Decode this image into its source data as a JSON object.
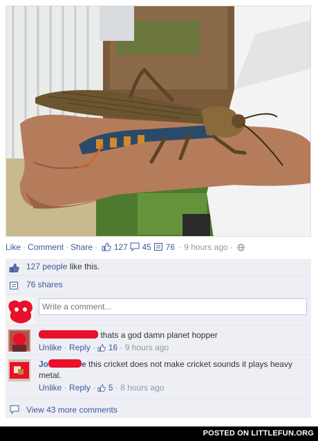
{
  "post": {
    "photo_subject": "giant grasshopper on a man's arm",
    "actions": {
      "like": "Like",
      "comment": "Comment",
      "share": "Share",
      "likes_count": "127",
      "comments_count": "45",
      "shares_count": "76",
      "time": "9 hours ago",
      "privacy_icon": "globe-icon"
    }
  },
  "feedback": {
    "likes_link": "127 people",
    "likes_text": " like this.",
    "shares_text": "76 shares",
    "write_placeholder": "Write a comment...",
    "comments": [
      {
        "author_prefix": "",
        "author_suffix": "",
        "text": "thats a god damn planet hopper",
        "unlike": "Unlike",
        "reply": "Reply",
        "likes": "16",
        "time": "9 hours ago"
      },
      {
        "author_prefix": "Jo",
        "author_suffix": "e",
        "text": "this cricket does not make cricket sounds it plays heavy metal.",
        "unlike": "Unlike",
        "reply": "Reply",
        "likes": "5",
        "time": "8 hours ago"
      }
    ],
    "view_more": "View 43 more comments"
  },
  "footer": {
    "text": "POSTED ON LITTLEFUN.ORG"
  },
  "colors": {
    "link": "#3b5998",
    "meta": "#9197a3",
    "feedback_bg": "#edeff4",
    "redaction": "#e8102a"
  }
}
